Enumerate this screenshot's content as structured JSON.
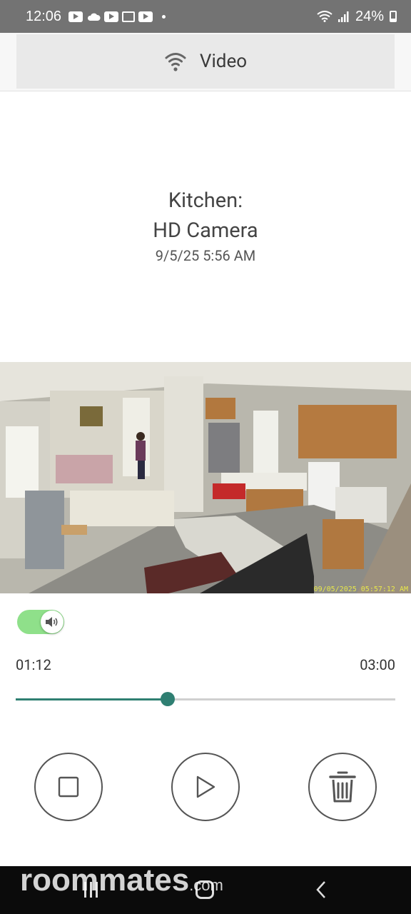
{
  "status_bar": {
    "time": "12:06",
    "battery": "24%"
  },
  "header": {
    "title": "Video",
    "icon": "wifi-icon"
  },
  "camera": {
    "name": "Kitchen:",
    "type": "HD Camera",
    "datetime": "9/5/25 5:56 AM"
  },
  "video": {
    "timestamp": "09/05/2025 05:57:12 AM"
  },
  "audio_toggle": {
    "on": true,
    "icon": "speaker-icon"
  },
  "playback": {
    "current": "01:12",
    "total": "03:00",
    "progress": 0.4
  },
  "controls": {
    "stop_icon": "stop-icon",
    "play_icon": "play-icon",
    "delete_icon": "trash-icon"
  },
  "watermark": {
    "text": "roommates",
    "suffix": ".com"
  },
  "colors": {
    "accent": "#2f7f72",
    "toggle_on": "#8fe08a",
    "status_bar": "#737373"
  }
}
